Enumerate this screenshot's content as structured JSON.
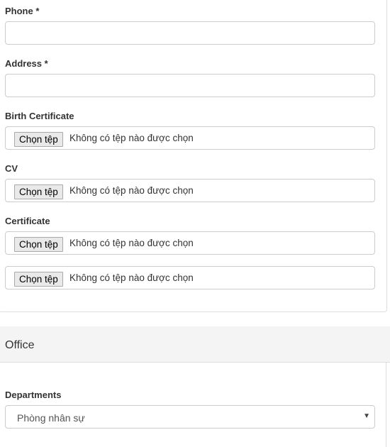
{
  "fields": {
    "phone_label": "Phone *",
    "phone_value": "",
    "address_label": "Address *",
    "address_value": "",
    "birth_certificate_label": "Birth Certificate",
    "cv_label": "CV",
    "certificate_label": "Certificate"
  },
  "file_input": {
    "button_label": "Chọn tệp",
    "no_file_text": "Không có tệp nào được chọn"
  },
  "office": {
    "header": "Office",
    "departments_label": "Departments",
    "departments_selected": "Phòng nhân sự"
  }
}
